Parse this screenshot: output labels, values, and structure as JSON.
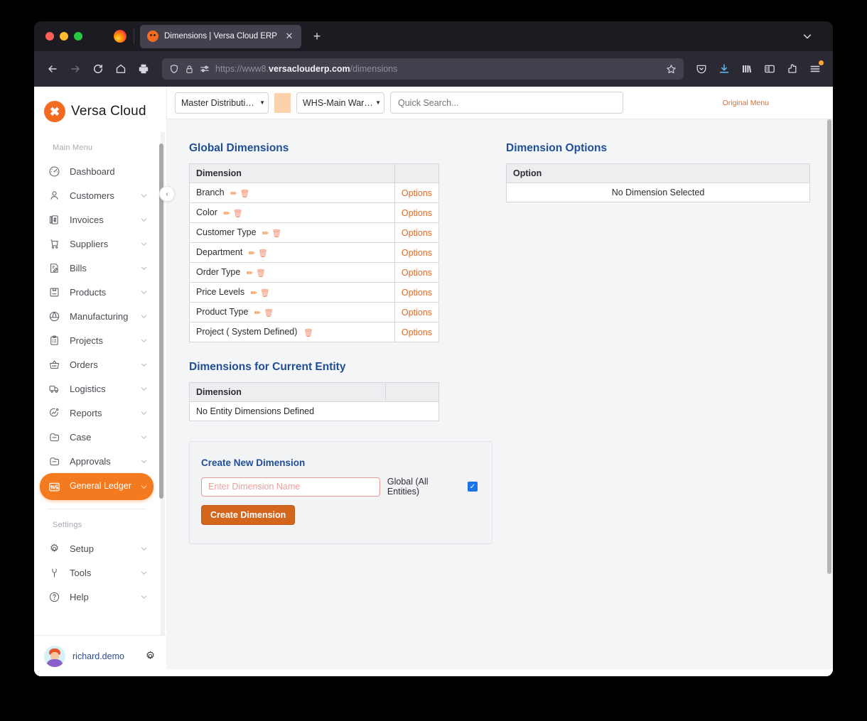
{
  "browser": {
    "tab": {
      "title": "Dimensions | Versa Cloud ERP",
      "favicon": "versa-cloud-icon",
      "close": "✕"
    },
    "new_tab": "+",
    "tabstrip_chevron": "chevron-down-icon",
    "nav": {
      "back": "back-icon",
      "forward": "forward-icon",
      "reload": "reload-icon",
      "home": "home-icon",
      "print": "print-icon"
    },
    "url": {
      "scheme": "https://www8.",
      "domain": "versaclouderp.com",
      "path": "/dimensions"
    },
    "toolbar_icons": [
      "shield-icon",
      "lock-icon",
      "tracking-protection-icon",
      "bookmark-star-icon",
      "pocket-icon",
      "downloads-icon",
      "library-icon",
      "sidebars-icon",
      "extensions-icon",
      "app-menu-icon"
    ]
  },
  "sidebar": {
    "brand": {
      "mark": "✖",
      "name": "Versa Cloud"
    },
    "collapse_toggle": "‹",
    "main_menu_label": "Main Menu",
    "items": [
      {
        "label": "Dashboard",
        "icon": "dashboard-icon",
        "chevron": false,
        "active": false
      },
      {
        "label": "Customers",
        "icon": "customers-icon",
        "chevron": true,
        "active": false
      },
      {
        "label": "Invoices",
        "icon": "invoices-icon",
        "chevron": true,
        "active": false
      },
      {
        "label": "Suppliers",
        "icon": "suppliers-icon",
        "chevron": true,
        "active": false
      },
      {
        "label": "Bills",
        "icon": "bills-icon",
        "chevron": true,
        "active": false
      },
      {
        "label": "Products",
        "icon": "products-icon",
        "chevron": true,
        "active": false
      },
      {
        "label": "Manufacturing",
        "icon": "manufacturing-icon",
        "chevron": true,
        "active": false
      },
      {
        "label": "Projects",
        "icon": "projects-icon",
        "chevron": true,
        "active": false
      },
      {
        "label": "Orders",
        "icon": "orders-icon",
        "chevron": true,
        "active": false
      },
      {
        "label": "Logistics",
        "icon": "logistics-icon",
        "chevron": true,
        "active": false
      },
      {
        "label": "Reports",
        "icon": "reports-icon",
        "chevron": true,
        "active": false
      },
      {
        "label": "Case",
        "icon": "case-icon",
        "chevron": true,
        "active": false
      },
      {
        "label": "Approvals",
        "icon": "approvals-icon",
        "chevron": true,
        "active": false
      },
      {
        "label": "General Ledger",
        "icon": "general-ledger-icon",
        "chevron": true,
        "active": true
      }
    ],
    "settings_label": "Settings",
    "settings_items": [
      {
        "label": "Setup",
        "icon": "gear-icon",
        "chevron": true
      },
      {
        "label": "Tools",
        "icon": "wrench-icon",
        "chevron": true
      },
      {
        "label": "Help",
        "icon": "help-icon",
        "chevron": true
      }
    ],
    "user": {
      "name": "richard.demo",
      "gear": "gear-icon"
    }
  },
  "topbar": {
    "entity": "Master Distribution I",
    "warehouse": "WHS-Main Warehous",
    "search_placeholder": "Quick Search...",
    "search_value": "",
    "original_menu": "Original Menu"
  },
  "main": {
    "global_dimensions": {
      "title": "Global Dimensions",
      "columns": [
        "Dimension",
        ""
      ],
      "rows": [
        {
          "name": "Branch",
          "edit": true,
          "delete": true,
          "options": "Options"
        },
        {
          "name": "Color",
          "edit": true,
          "delete": true,
          "options": "Options"
        },
        {
          "name": "Customer Type",
          "edit": true,
          "delete": true,
          "options": "Options"
        },
        {
          "name": "Department",
          "edit": true,
          "delete": true,
          "options": "Options"
        },
        {
          "name": "Order Type",
          "edit": true,
          "delete": true,
          "options": "Options"
        },
        {
          "name": "Price Levels",
          "edit": true,
          "delete": true,
          "options": "Options"
        },
        {
          "name": "Product Type",
          "edit": true,
          "delete": true,
          "options": "Options"
        },
        {
          "name": "Project ( System Defined)",
          "edit": false,
          "delete": true,
          "options": "Options"
        }
      ]
    },
    "entity_dimensions": {
      "title": "Dimensions for Current Entity",
      "columns": [
        "Dimension",
        ""
      ],
      "empty_message": "No Entity Dimensions Defined"
    },
    "create_dimension": {
      "title": "Create New Dimension",
      "input_placeholder": "Enter Dimension Name",
      "input_value": "",
      "global_label": "Global (All Entities)",
      "global_checked": true,
      "checkmark": "✓",
      "button_label": "Create Dimension"
    },
    "dimension_options": {
      "title": "Dimension Options",
      "columns": [
        "Option"
      ],
      "empty_message": "No Dimension Selected"
    }
  },
  "colors": {
    "brand_orange": "#f47a20",
    "heading_blue": "#1f4e96",
    "link_orange": "#e06a28",
    "button_orange": "#d3651c",
    "checkbox_blue": "#1a73e8",
    "page_bg": "#f4f5f7"
  }
}
